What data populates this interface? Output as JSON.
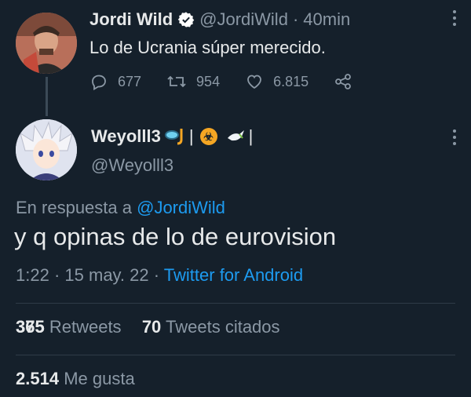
{
  "parent_tweet": {
    "author_name": "Jordi Wild",
    "handle": "@JordiWild",
    "time": "40min",
    "text": "Lo de Ucrania súper merecido.",
    "replies": "677",
    "retweets": "954",
    "likes": "6.815"
  },
  "reply_tweet": {
    "author_name": "Weyolll3",
    "handle": "@Weyolll3",
    "replying_prefix": "En respuesta a",
    "replying_to": "@JordiWild",
    "text": "y q opinas de lo de eurovision",
    "time": "1:22",
    "date": "15 may. 22",
    "source": "Twitter for Android",
    "retweets_a": "375",
    "retweets_b": "365",
    "retweets_label": "Retweets",
    "quotes": "70",
    "quotes_label": "Tweets citados",
    "likes": "2.514",
    "likes_label": "Me gusta"
  },
  "colors": {
    "background": "#15202b",
    "text": "#e7e9ea",
    "muted": "#8b98a5",
    "link": "#1d9bf0",
    "verified": "#ffffff"
  },
  "icons": [
    "verified-badge-icon",
    "reply-icon",
    "retweet-icon",
    "like-icon",
    "share-icon",
    "more-icon",
    "snorkel-emoji-icon",
    "biohazard-emoji-icon",
    "dove-emoji-icon"
  ]
}
